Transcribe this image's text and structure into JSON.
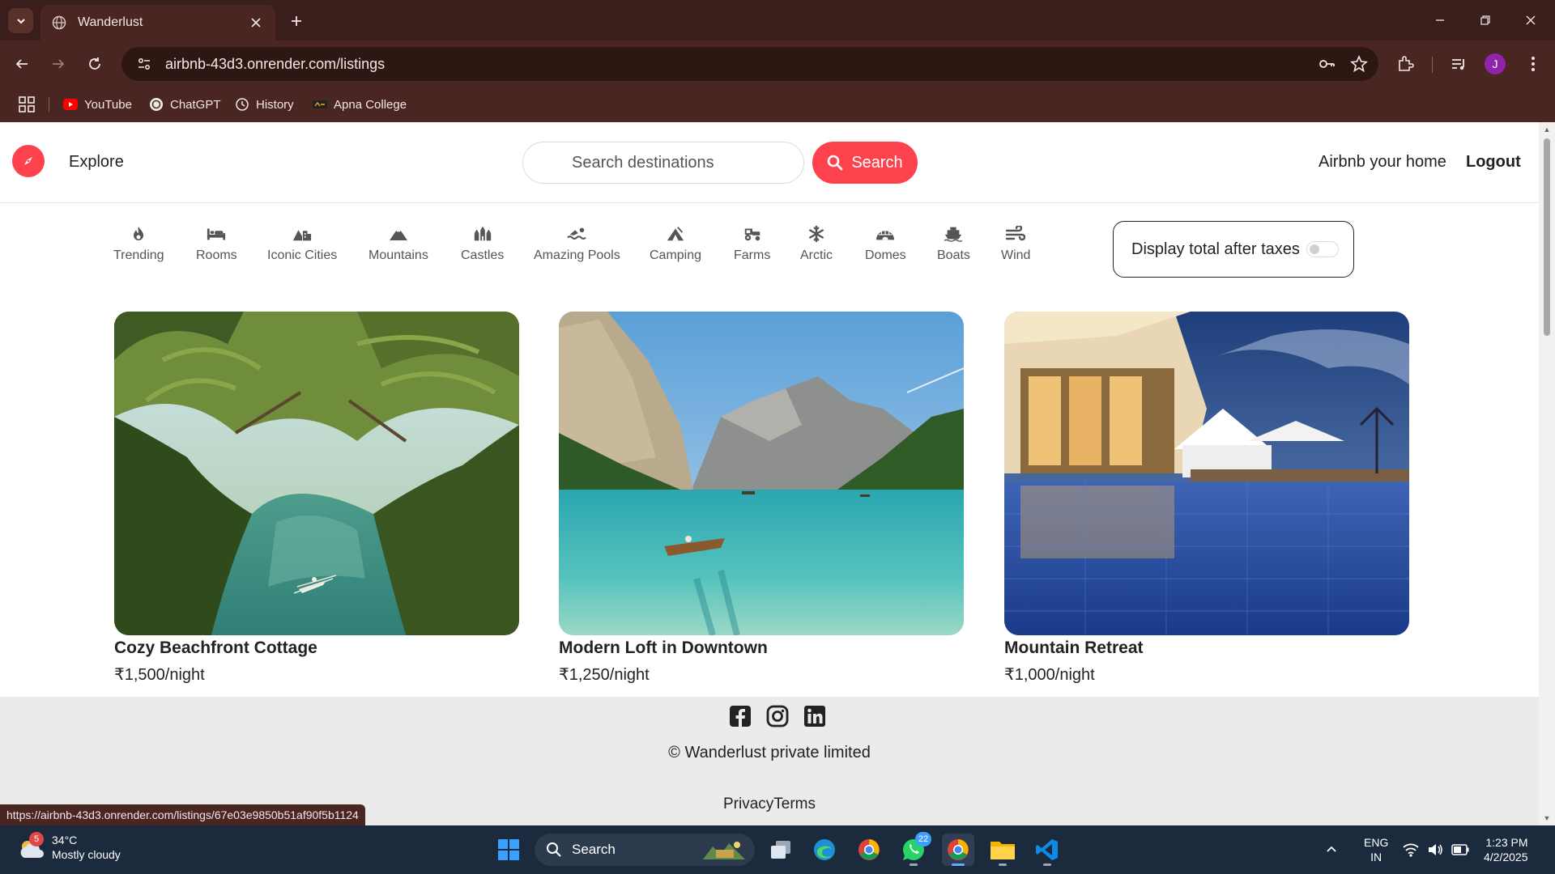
{
  "browser": {
    "tab_title": "Wanderlust",
    "url": "airbnb-43d3.onrender.com/listings",
    "bookmarks": [
      {
        "label": "YouTube",
        "icon": "youtube-icon"
      },
      {
        "label": "ChatGPT",
        "icon": "chatgpt-icon"
      },
      {
        "label": "History",
        "icon": "history-icon"
      },
      {
        "label": "Apna College",
        "icon": "apna-college-icon"
      }
    ],
    "profile_initial": "J",
    "status_url": "https://airbnb-43d3.onrender.com/listings/67e03e9850b51af90f5b1124"
  },
  "nav": {
    "explore": "Explore",
    "search_placeholder": "Search destinations",
    "search_button": "Search",
    "host_link": "Airbnb your home",
    "logout": "Logout"
  },
  "filters": [
    {
      "label": "Trending",
      "icon": "fire-icon"
    },
    {
      "label": "Rooms",
      "icon": "bed-icon"
    },
    {
      "label": "Iconic Cities",
      "icon": "mountain-city-icon"
    },
    {
      "label": "Mountains",
      "icon": "mountain-icon"
    },
    {
      "label": "Castles",
      "icon": "castle-icon"
    },
    {
      "label": "Amazing Pools",
      "icon": "person-swimming-icon"
    },
    {
      "label": "Camping",
      "icon": "campground-icon"
    },
    {
      "label": "Farms",
      "icon": "tractor-icon"
    },
    {
      "label": "Arctic",
      "icon": "snowflake-icon"
    },
    {
      "label": "Domes",
      "icon": "igloo-icon"
    },
    {
      "label": "Boats",
      "icon": "ship-icon"
    },
    {
      "label": "Wind",
      "icon": "wind-icon"
    }
  ],
  "tax_toggle": {
    "label": "Display total after taxes",
    "enabled": false
  },
  "listings": [
    {
      "title": "Cozy Beachfront Cottage",
      "price": "₹1,500/night"
    },
    {
      "title": "Modern Loft in Downtown",
      "price": "₹1,250/night"
    },
    {
      "title": "Mountain Retreat",
      "price": "₹1,000/night"
    }
  ],
  "footer": {
    "copyright": "© Wanderlust private limited",
    "links": "PrivacyTerms"
  },
  "taskbar": {
    "weather_temp": "34°C",
    "weather_desc": "Mostly cloudy",
    "weather_badge": "5",
    "search_label": "Search",
    "whatsapp_badge": "22",
    "lang_top": "ENG",
    "lang_bottom": "IN",
    "time": "1:23 PM",
    "date": "4/2/2025"
  },
  "colors": {
    "brand": "#fe424d",
    "chrome": "#4a2622",
    "taskbar": "#1c2a3d"
  }
}
